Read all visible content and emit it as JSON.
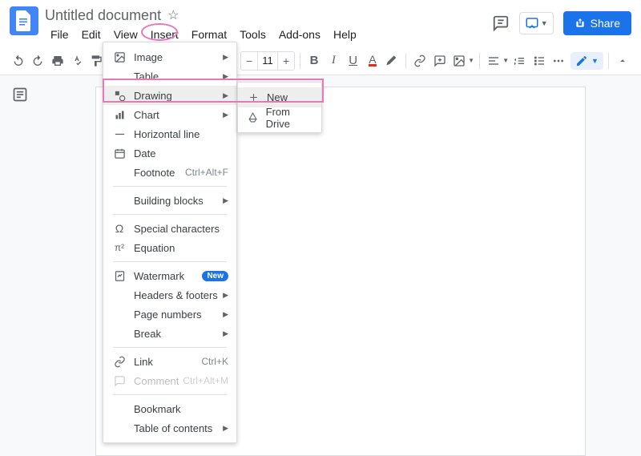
{
  "header": {
    "title": "Untitled document",
    "menus": [
      "File",
      "Edit",
      "View",
      "Insert",
      "Format",
      "Tools",
      "Add-ons",
      "Help"
    ],
    "share_label": "Share"
  },
  "toolbar": {
    "font_size": "11"
  },
  "insert_menu": {
    "image": "Image",
    "table": "Table",
    "drawing": "Drawing",
    "chart": "Chart",
    "horizontal_line": "Horizontal line",
    "date": "Date",
    "footnote": "Footnote",
    "footnote_shortcut": "Ctrl+Alt+F",
    "building_blocks": "Building blocks",
    "special_chars": "Special characters",
    "equation": "Equation",
    "watermark": "Watermark",
    "watermark_badge": "New",
    "headers_footers": "Headers & footers",
    "page_numbers": "Page numbers",
    "break": "Break",
    "link": "Link",
    "link_shortcut": "Ctrl+K",
    "comment": "Comment",
    "comment_shortcut": "Ctrl+Alt+M",
    "bookmark": "Bookmark",
    "toc": "Table of contents"
  },
  "drawing_submenu": {
    "new": "New",
    "from_drive": "From Drive"
  }
}
